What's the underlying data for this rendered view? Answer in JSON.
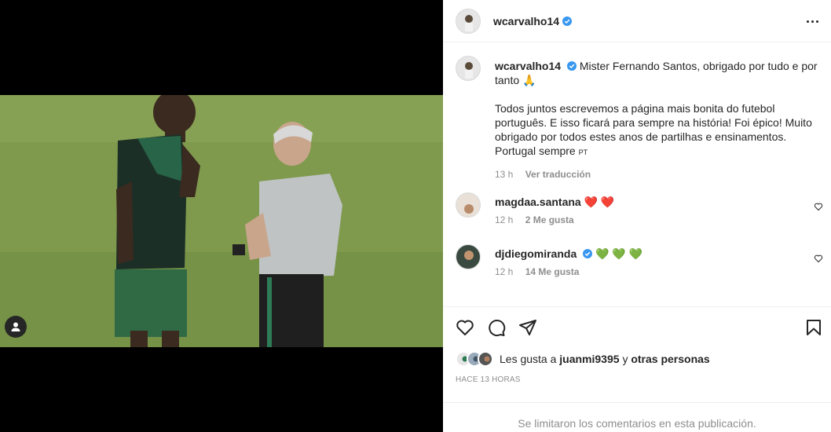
{
  "post": {
    "username": "wcarvalho14",
    "more_icon": "more-horizontal-icon"
  },
  "caption": {
    "username": "wcarvalho14",
    "line1": "Mister Fernando Santos, obrigado por tudo e por tanto",
    "emoji": "🙏",
    "paragraph2": "Todos juntos escrevemos a página mais bonita do futebol português. E isso ficará para sempre na história! Foi épico! Muito obrigado por todos estes anos de partilhas e ensinamentos. Portugal sempre",
    "flag": "PT",
    "time": "13 h",
    "translate": "Ver traducción"
  },
  "comments": [
    {
      "username": "magdaa.santana",
      "text": "❤️ ❤️",
      "time": "12 h",
      "likes": "2 Me gusta",
      "verified": false
    },
    {
      "username": "djdiegomiranda",
      "text": "💚 💚 💚",
      "time": "12 h",
      "likes": "14 Me gusta",
      "verified": true
    }
  ],
  "actions": {
    "like_icon": "heart-icon",
    "comment_icon": "comment-icon",
    "share_icon": "send-icon",
    "save_icon": "bookmark-icon"
  },
  "likes": {
    "prefix": "Les gusta a",
    "user": "juanmi9395",
    "joiner": "y",
    "others": "otras personas"
  },
  "date": "HACE 13 HORAS",
  "limited_notice": "Se limitaron los comentarios en esta publicación.",
  "colors": {
    "verified": "#3897f0",
    "heart_red": "#ed4956",
    "heart_green": "#2ecc40",
    "muted": "#8e8e8e"
  }
}
